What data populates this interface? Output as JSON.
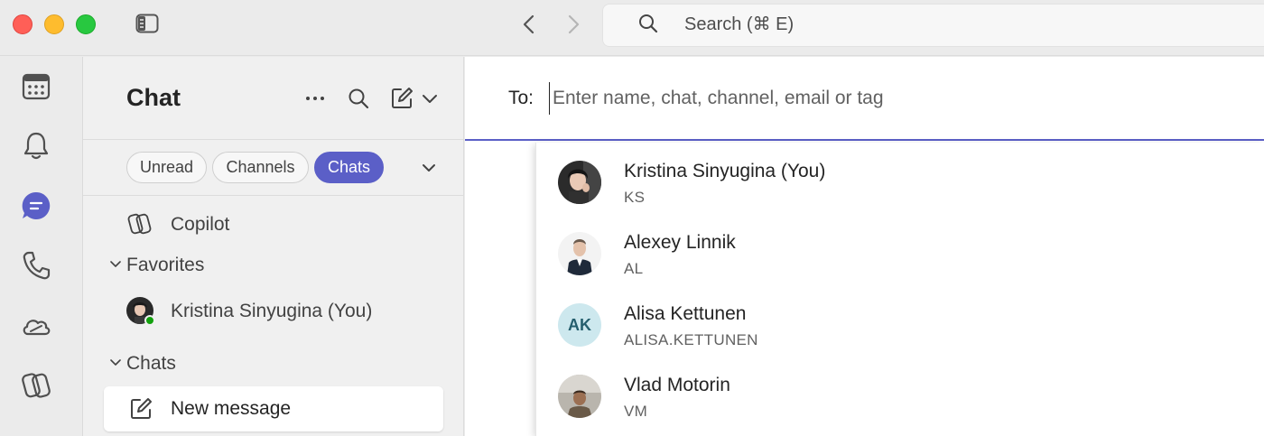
{
  "search": {
    "placeholder": "Search (⌘ E)"
  },
  "rail": {
    "items": [
      {
        "icon": "calendar-icon"
      },
      {
        "icon": "bell-icon"
      },
      {
        "icon": "chat-icon",
        "active": true
      },
      {
        "icon": "phone-icon"
      },
      {
        "icon": "cloud-icon"
      },
      {
        "icon": "copilot-icon"
      }
    ]
  },
  "list": {
    "title": "Chat",
    "filters": [
      {
        "label": "Unread",
        "active": false
      },
      {
        "label": "Channels",
        "active": false
      },
      {
        "label": "Chats",
        "active": true
      }
    ],
    "copilot_label": "Copilot",
    "favorites_label": "Favorites",
    "favorite_item": "Kristina Sinyugina (You)",
    "chats_label": "Chats",
    "new_message_label": "New message"
  },
  "compose": {
    "to_label": "To:",
    "placeholder": "Enter name, chat, channel, email or tag"
  },
  "suggestions": [
    {
      "name": "Kristina Sinyugina (You)",
      "sub": "KS",
      "avatar": "photo"
    },
    {
      "name": "Alexey Linnik",
      "sub": "AL",
      "avatar": "photo"
    },
    {
      "name": "Alisa Kettunen",
      "sub": "ALISA.KETTUNEN",
      "avatar": "initials",
      "initials": "AK"
    },
    {
      "name": "Vlad Motorin",
      "sub": "VM",
      "avatar": "photo"
    }
  ],
  "colors": {
    "accent": "#5b5fc7",
    "presence": "#13a10e"
  }
}
